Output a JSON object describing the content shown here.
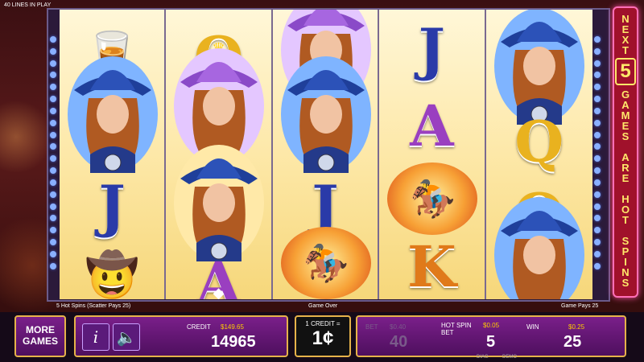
{
  "top": {
    "lines_in_play": "40 LINES IN PLAY"
  },
  "reels": [
    [
      "glass-icon",
      "cowgirl-wild-icon",
      "J",
      "hat-icon"
    ],
    [
      "Q",
      "cowgirl-purple-icon",
      "cowgirl-wild-icon",
      "A"
    ],
    [
      "cowgirl-purple-icon",
      "cowgirl-wild-icon",
      "J",
      "horse-rider-icon"
    ],
    [
      "J",
      "A",
      "horse-rider-icon",
      "K"
    ],
    [
      "cowgirl-wild-icon",
      "Q",
      "Q",
      "cowgirl-wild-icon"
    ]
  ],
  "side_banner": {
    "next": "NEXT",
    "count": "5",
    "games_are_hot_spins": "GAMES ARE HOT SPINS"
  },
  "status": {
    "left": "5 Hot Spins (Scatter Pays 25)",
    "center": "Game Over",
    "right": "Game Pays 25"
  },
  "controls": {
    "more_games_line1": "MORE",
    "more_games_line2": "GAMES",
    "info_label": "i",
    "sound_label": "🔈",
    "credit_label": "CREDIT",
    "credit_money": "$149.65",
    "credit_value": "14965",
    "denom_label": "1 CREDIT =",
    "denom_value": "1¢",
    "bet_label": "BET",
    "bet_money": "$0.40",
    "bet_value": "40",
    "hot_spin_bet_label_1": "HOT SPIN",
    "hot_spin_bet_label_2": "BET",
    "hot_spin_bet_money": "$0.05",
    "hot_spin_bet_value": "5",
    "win_label": "WIN",
    "win_money": "$0.25",
    "win_value": "25",
    "diag": "DIAG",
    "demo": "DEMO"
  },
  "colors": {
    "frame_border": "#e6b24a",
    "panel": "#7a1f8a",
    "banner": "#a0112b",
    "banner_text": "#ffe86a"
  }
}
